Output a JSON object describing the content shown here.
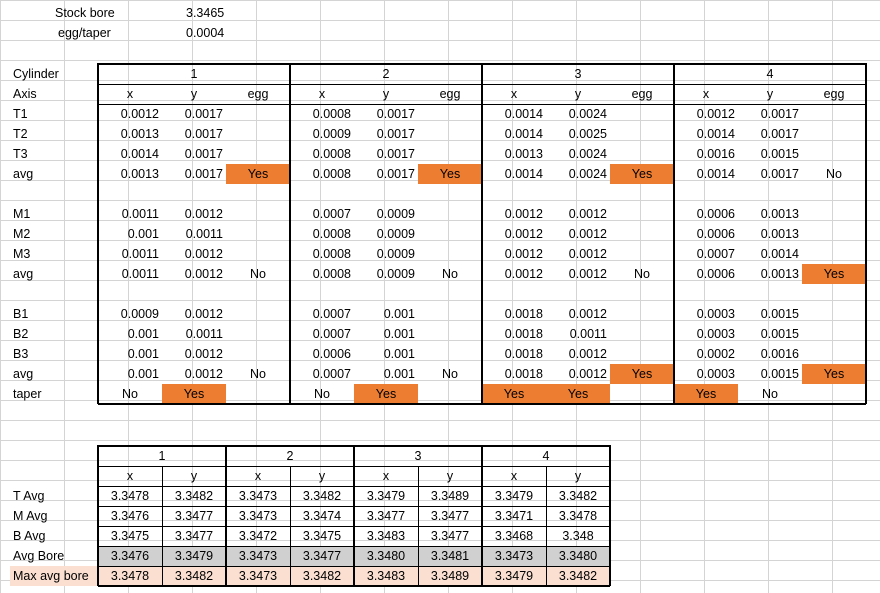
{
  "header": {
    "stock_bore_label": "Stock bore",
    "stock_bore_value": "3.3465",
    "egg_taper_label": "egg/taper",
    "egg_taper_value": "0.0004"
  },
  "colors": {
    "orange": "#ed7d31",
    "grey": "#d0d0d0",
    "peach": "#fbe0d2"
  },
  "top_table": {
    "cylinder_label": "Cylinder",
    "axis_label": "Axis",
    "cylinders": [
      "1",
      "2",
      "3",
      "4"
    ],
    "subheaders": [
      "x",
      "y",
      "egg"
    ],
    "rows": [
      {
        "label": "T1",
        "cells": [
          [
            "0.0012",
            "0.0017",
            ""
          ],
          [
            "0.0008",
            "0.0017",
            ""
          ],
          [
            "0.0014",
            "0.0024",
            ""
          ],
          [
            "0.0012",
            "0.0017",
            ""
          ]
        ]
      },
      {
        "label": "T2",
        "cells": [
          [
            "0.0013",
            "0.0017",
            ""
          ],
          [
            "0.0009",
            "0.0017",
            ""
          ],
          [
            "0.0014",
            "0.0025",
            ""
          ],
          [
            "0.0014",
            "0.0017",
            ""
          ]
        ]
      },
      {
        "label": "T3",
        "cells": [
          [
            "0.0014",
            "0.0017",
            ""
          ],
          [
            "0.0008",
            "0.0017",
            ""
          ],
          [
            "0.0013",
            "0.0024",
            ""
          ],
          [
            "0.0016",
            "0.0015",
            ""
          ]
        ]
      },
      {
        "label": "avg",
        "cells": [
          [
            "0.0013",
            "0.0017",
            "Yes"
          ],
          [
            "0.0008",
            "0.0017",
            "Yes"
          ],
          [
            "0.0014",
            "0.0024",
            "Yes"
          ],
          [
            "0.0014",
            "0.0017",
            "No"
          ]
        ],
        "highlight": [
          [
            false,
            false,
            true
          ],
          [
            false,
            false,
            true
          ],
          [
            false,
            false,
            true
          ],
          [
            false,
            false,
            false
          ]
        ]
      },
      {
        "label": "",
        "cells": [
          [
            "",
            "",
            ""
          ],
          [
            "",
            "",
            ""
          ],
          [
            "",
            "",
            ""
          ],
          [
            "",
            "",
            ""
          ]
        ]
      },
      {
        "label": "M1",
        "cells": [
          [
            "0.0011",
            "0.0012",
            ""
          ],
          [
            "0.0007",
            "0.0009",
            ""
          ],
          [
            "0.0012",
            "0.0012",
            ""
          ],
          [
            "0.0006",
            "0.0013",
            ""
          ]
        ]
      },
      {
        "label": "M2",
        "cells": [
          [
            "0.001",
            "0.0011",
            ""
          ],
          [
            "0.0008",
            "0.0009",
            ""
          ],
          [
            "0.0012",
            "0.0012",
            ""
          ],
          [
            "0.0006",
            "0.0013",
            ""
          ]
        ]
      },
      {
        "label": "M3",
        "cells": [
          [
            "0.0011",
            "0.0012",
            ""
          ],
          [
            "0.0008",
            "0.0009",
            ""
          ],
          [
            "0.0012",
            "0.0012",
            ""
          ],
          [
            "0.0007",
            "0.0014",
            ""
          ]
        ]
      },
      {
        "label": "avg",
        "cells": [
          [
            "0.0011",
            "0.0012",
            "No"
          ],
          [
            "0.0008",
            "0.0009",
            "No"
          ],
          [
            "0.0012",
            "0.0012",
            "No"
          ],
          [
            "0.0006",
            "0.0013",
            "Yes"
          ]
        ],
        "highlight": [
          [
            false,
            false,
            false
          ],
          [
            false,
            false,
            false
          ],
          [
            false,
            false,
            false
          ],
          [
            false,
            false,
            true
          ]
        ]
      },
      {
        "label": "",
        "cells": [
          [
            "",
            "",
            ""
          ],
          [
            "",
            "",
            ""
          ],
          [
            "",
            "",
            ""
          ],
          [
            "",
            "",
            ""
          ]
        ]
      },
      {
        "label": "B1",
        "cells": [
          [
            "0.0009",
            "0.0012",
            ""
          ],
          [
            "0.0007",
            "0.001",
            ""
          ],
          [
            "0.0018",
            "0.0012",
            ""
          ],
          [
            "0.0003",
            "0.0015",
            ""
          ]
        ]
      },
      {
        "label": "B2",
        "cells": [
          [
            "0.001",
            "0.0011",
            ""
          ],
          [
            "0.0007",
            "0.001",
            ""
          ],
          [
            "0.0018",
            "0.0011",
            ""
          ],
          [
            "0.0003",
            "0.0015",
            ""
          ]
        ]
      },
      {
        "label": "B3",
        "cells": [
          [
            "0.001",
            "0.0012",
            ""
          ],
          [
            "0.0006",
            "0.001",
            ""
          ],
          [
            "0.0018",
            "0.0012",
            ""
          ],
          [
            "0.0002",
            "0.0016",
            ""
          ]
        ]
      },
      {
        "label": "avg",
        "cells": [
          [
            "0.001",
            "0.0012",
            "No"
          ],
          [
            "0.0007",
            "0.001",
            "No"
          ],
          [
            "0.0018",
            "0.0012",
            "Yes"
          ],
          [
            "0.0003",
            "0.0015",
            "Yes"
          ]
        ],
        "highlight": [
          [
            false,
            false,
            false
          ],
          [
            false,
            false,
            false
          ],
          [
            false,
            false,
            true
          ],
          [
            false,
            false,
            true
          ]
        ]
      },
      {
        "label": "taper",
        "cells": [
          [
            "No",
            "Yes",
            ""
          ],
          [
            "No",
            "Yes",
            ""
          ],
          [
            "Yes",
            "Yes",
            ""
          ],
          [
            "Yes",
            "No",
            ""
          ]
        ],
        "highlight": [
          [
            false,
            true,
            false
          ],
          [
            false,
            true,
            false
          ],
          [
            true,
            true,
            false
          ],
          [
            true,
            false,
            false
          ]
        ]
      }
    ]
  },
  "bottom_table": {
    "cylinders": [
      "1",
      "2",
      "3",
      "4"
    ],
    "subheaders": [
      "x",
      "y"
    ],
    "rows": [
      {
        "label": "T Avg",
        "values": [
          "3.3478",
          "3.3482",
          "3.3473",
          "3.3482",
          "3.3479",
          "3.3489",
          "3.3479",
          "3.3482"
        ],
        "fill": ""
      },
      {
        "label": "M Avg",
        "values": [
          "3.3476",
          "3.3477",
          "3.3473",
          "3.3474",
          "3.3477",
          "3.3477",
          "3.3471",
          "3.3478"
        ],
        "fill": ""
      },
      {
        "label": "B Avg",
        "values": [
          "3.3475",
          "3.3477",
          "3.3472",
          "3.3475",
          "3.3483",
          "3.3477",
          "3.3468",
          "3.348"
        ],
        "fill": ""
      },
      {
        "label": "Avg Bore",
        "values": [
          "3.3476",
          "3.3479",
          "3.3473",
          "3.3477",
          "3.3480",
          "3.3481",
          "3.3473",
          "3.3480"
        ],
        "fill": "grey"
      },
      {
        "label": "Max avg bore",
        "values": [
          "3.3478",
          "3.3482",
          "3.3473",
          "3.3482",
          "3.3483",
          "3.3489",
          "3.3479",
          "3.3482"
        ],
        "fill": "peach"
      }
    ]
  }
}
